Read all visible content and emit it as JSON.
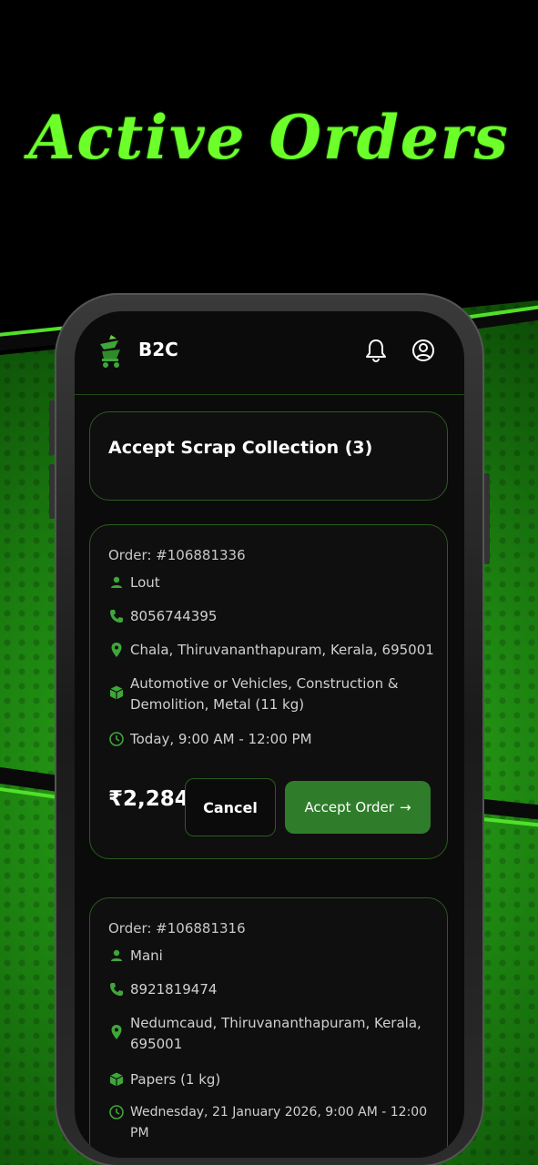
{
  "promo": {
    "title": "Active Orders"
  },
  "header": {
    "brand": "B2C"
  },
  "section": {
    "title": "Accept Scrap Collection (3)"
  },
  "orders": [
    {
      "id": "Order: #106881336",
      "name": "Lout",
      "phone": "8056744395",
      "address": "Chala, Thiruvananthapuram, Kerala, 695001",
      "items": "Automotive or Vehicles, Construction & Demolition, Metal (11 kg)",
      "time": "Today, 9:00 AM - 12:00 PM",
      "price": "₹2,284",
      "cancel_label": "Cancel",
      "accept_label": "Accept Order",
      "accept_arrow": "→"
    },
    {
      "id": "Order: #106881316",
      "name": "Mani",
      "phone": "8921819474",
      "address": "Nedumcaud, Thiruvananthapuram, Kerala, 695001",
      "items": "Papers (1 kg)",
      "time": "Wednesday, 21 January 2026, 9:00 AM - 12:00 PM"
    }
  ],
  "colors": {
    "accent": "#2f7d2a",
    "icon_green": "#3fa63a",
    "promo_green": "#6cff2a"
  }
}
